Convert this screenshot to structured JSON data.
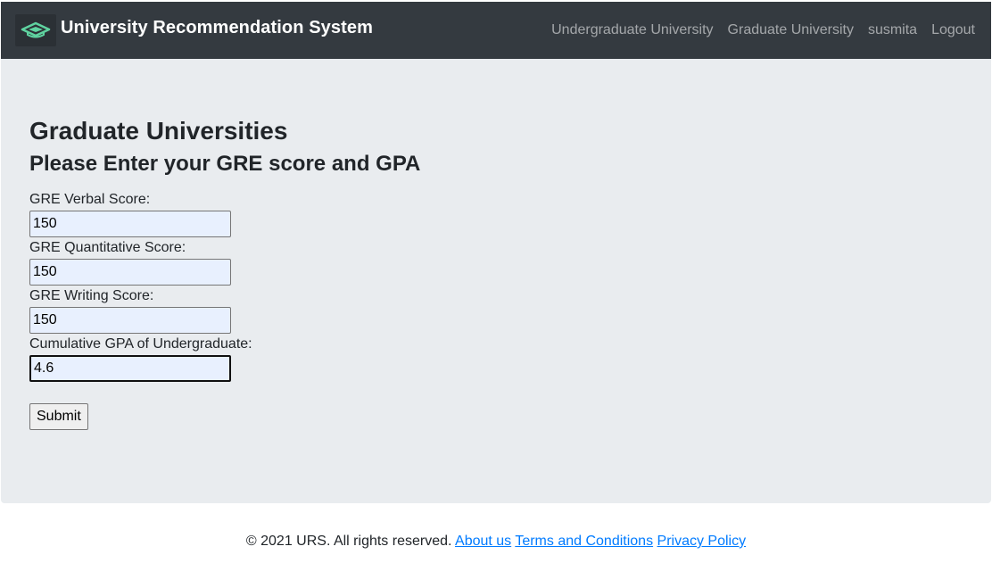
{
  "navbar": {
    "brand_title": "University Recommendation System",
    "brand_icon": "graduation-cap-icon",
    "links": [
      {
        "label": "Undergraduate University"
      },
      {
        "label": "Graduate University"
      },
      {
        "label": "susmita"
      },
      {
        "label": "Logout"
      }
    ]
  },
  "main": {
    "title": "Graduate Universities",
    "subtitle": "Please Enter your GRE score and GPA",
    "fields": [
      {
        "label": "GRE Verbal Score:",
        "value": "150"
      },
      {
        "label": "GRE Quantitative Score:",
        "value": "150"
      },
      {
        "label": "GRE Writing Score:",
        "value": "150"
      },
      {
        "label": "Cumulative GPA of Undergraduate:",
        "value": "4.6"
      }
    ],
    "submit_label": "Submit"
  },
  "footer": {
    "copyright": "© 2021 URS. All rights reserved.",
    "links": [
      {
        "label": "About us"
      },
      {
        "label": "Terms and Conditions"
      },
      {
        "label": "Privacy Policy"
      }
    ]
  },
  "colors": {
    "navbar_bg": "#343a40",
    "jumbotron_bg": "#e9ecef",
    "link": "#007bff",
    "logo_accent": "#5fd3a0"
  }
}
